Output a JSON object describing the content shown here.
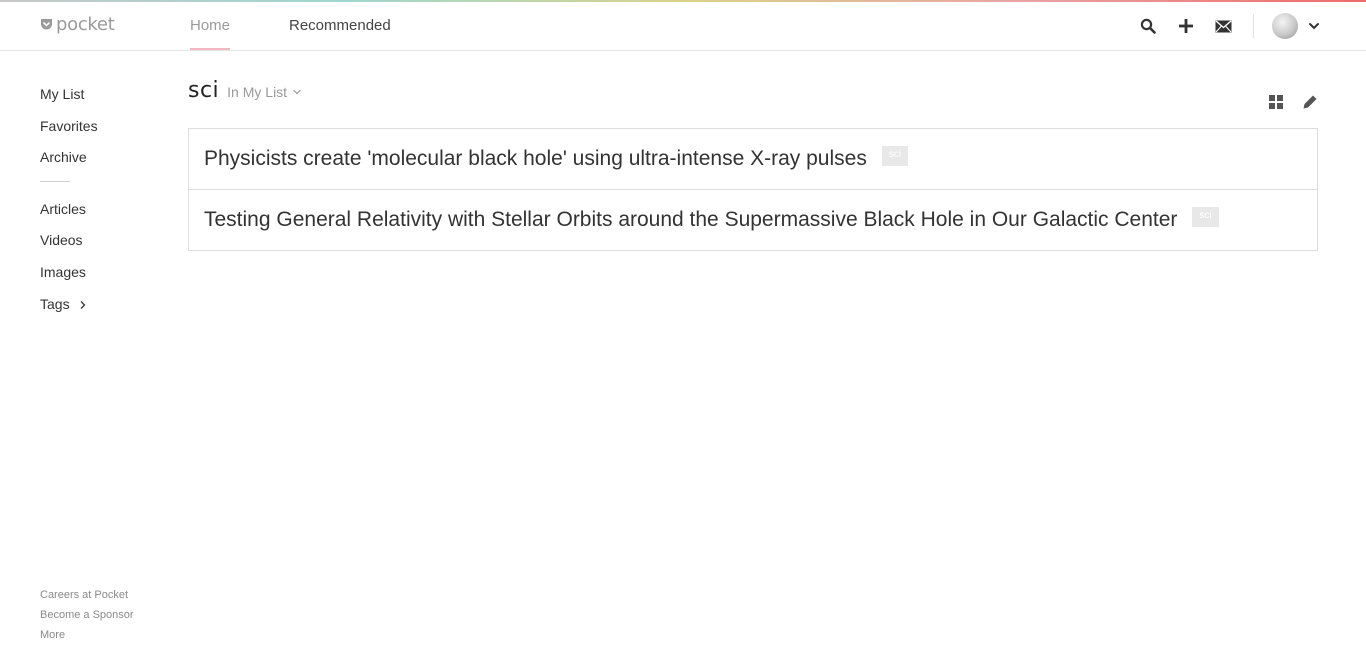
{
  "app": {
    "logo_text": "pocket"
  },
  "nav": {
    "tabs": [
      {
        "label": "Home"
      },
      {
        "label": "Recommended"
      }
    ]
  },
  "topbar": {
    "icons": [
      "search-icon",
      "plus-icon",
      "envelope-icon",
      "avatar",
      "chevron-down-icon"
    ]
  },
  "sidebar": {
    "items": [
      {
        "label": "My List"
      },
      {
        "label": "Favorites"
      },
      {
        "label": "Archive"
      },
      {
        "label": "Articles"
      },
      {
        "label": "Videos"
      },
      {
        "label": "Images"
      },
      {
        "label": "Tags"
      }
    ],
    "footer": [
      {
        "label": "Careers at Pocket"
      },
      {
        "label": "Become a Sponsor"
      },
      {
        "label": "More"
      }
    ]
  },
  "main": {
    "tag_title": "sci",
    "scope": "In My List",
    "view_icons": [
      "grid-view-icon",
      "edit-pencil-icon"
    ],
    "items": [
      {
        "title": "Physicists create 'molecular black hole' using ultra-intense X-ray pulses",
        "tag": "sci"
      },
      {
        "title": "Testing General Relativity with Stellar Orbits around the Supermassive Black Hole in Our Galactic Center",
        "tag": "sci"
      }
    ]
  },
  "colors": {
    "accent_underline": "#f2b7bf",
    "tag_bg": "#e8e8e8",
    "muted_text": "#9a9a9a"
  }
}
